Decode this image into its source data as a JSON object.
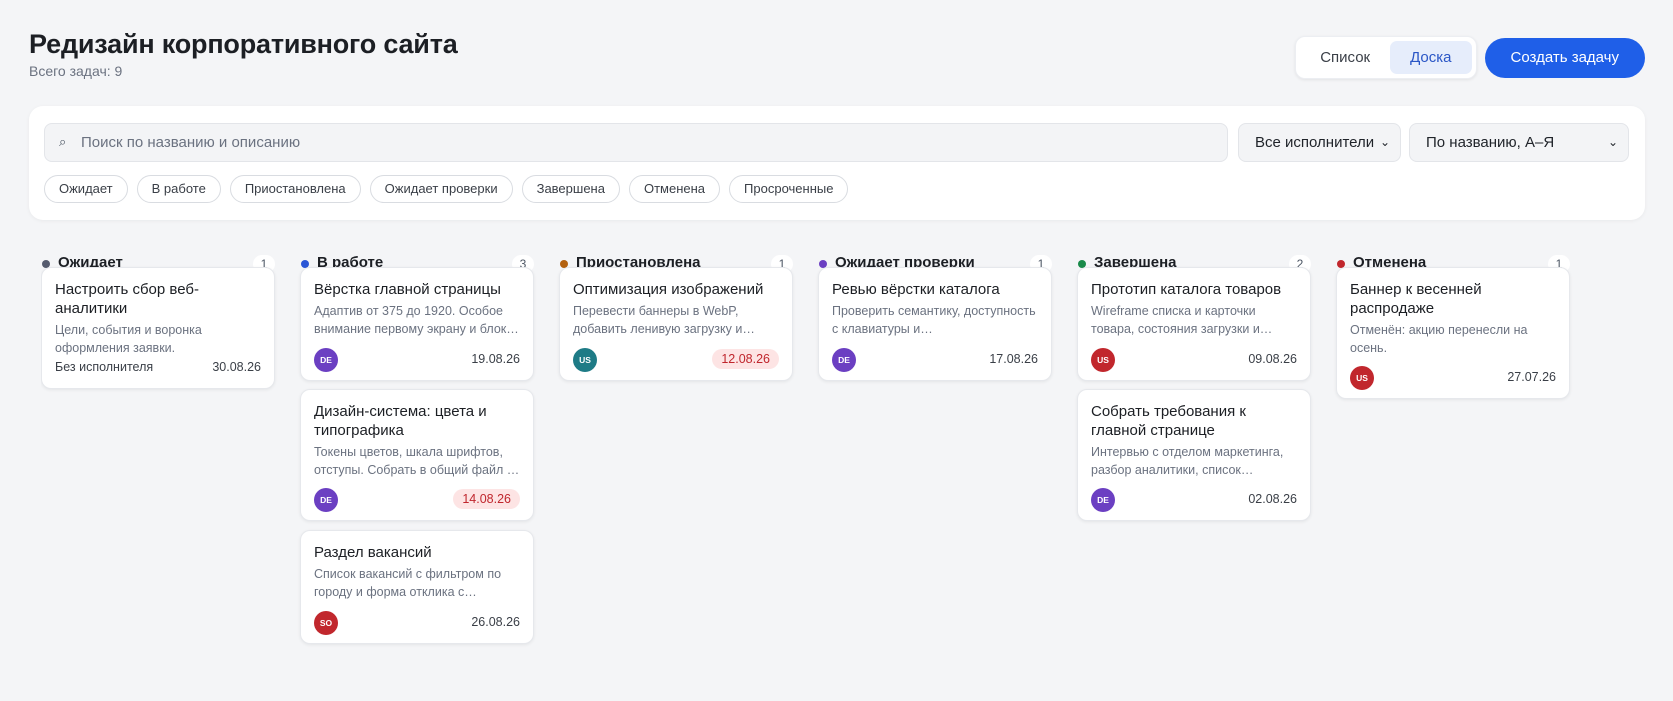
{
  "header": {
    "title": "Редизайн корпоративного сайта",
    "subtitle": "Всего задач: 9",
    "view_list": "Список",
    "view_board": "Доска",
    "create_label": "Создать задачу"
  },
  "filters": {
    "search_placeholder": "Поиск по названию и описанию",
    "search_value": "",
    "assignee_selected": "Все исполнители",
    "sort_selected": "По названию, А–Я",
    "chips": [
      "Ожидает",
      "В работе",
      "Приостановлена",
      "Ожидает проверки",
      "Завершена",
      "Отменена",
      "Просроченные"
    ]
  },
  "columns": [
    {
      "title": "Ожидает",
      "count": "1",
      "color": "#555b6e",
      "cards": [
        {
          "title": "Настроить сбор веб-аналитики",
          "desc": "Цели, события и воронка оформления заявки.",
          "assignee": "",
          "no_assignee_label": "Без исполнителя",
          "avatar_color": "",
          "date": "30.08.26",
          "overdue": false
        }
      ]
    },
    {
      "title": "В работе",
      "count": "3",
      "color": "#2a56d6",
      "cards": [
        {
          "title": "Вёрстка главной страницы",
          "desc": "Адаптив от 375 до 1920. Особое внимание первому экрану и блок…",
          "assignee": "DE",
          "avatar_color": "#6b3fc2",
          "date": "19.08.26",
          "overdue": false
        },
        {
          "title": "Дизайн-система: цвета и типографика",
          "desc": "Токены цветов, шкала шрифтов, отступы. Собрать в общий файл …",
          "assignee": "DE",
          "avatar_color": "#6b3fc2",
          "date": "14.08.26",
          "overdue": true
        },
        {
          "title": "Раздел вакансий",
          "desc": "Список вакансий с фильтром по городу и форма отклика с…",
          "assignee": "SO",
          "avatar_color": "#c1272d",
          "date": "26.08.26",
          "overdue": false
        }
      ]
    },
    {
      "title": "Приостановлена",
      "count": "1",
      "color": "#b3610f",
      "cards": [
        {
          "title": "Оптимизация изображений",
          "desc": "Перевести баннеры в WebP, добавить ленивую загрузку и…",
          "assignee": "US",
          "avatar_color": "#1e7b86",
          "date": "12.08.26",
          "overdue": true
        }
      ]
    },
    {
      "title": "Ожидает проверки",
      "count": "1",
      "color": "#6b3fc2",
      "cards": [
        {
          "title": "Ревью вёрстки каталога",
          "desc": "Проверить семантику, доступность с клавиатуры и…",
          "assignee": "DE",
          "avatar_color": "#6b3fc2",
          "date": "17.08.26",
          "overdue": false
        }
      ]
    },
    {
      "title": "Завершена",
      "count": "2",
      "color": "#1a8a4a",
      "cards": [
        {
          "title": "Прототип каталога товаров",
          "desc": "Wireframe списка и карточки товара, состояния загрузки и…",
          "assignee": "US",
          "avatar_color": "#c1272d",
          "date": "09.08.26",
          "overdue": false
        },
        {
          "title": "Собрать требования к главной странице",
          "desc": "Интервью с отделом маркетинга, разбор аналитики, список…",
          "assignee": "DE",
          "avatar_color": "#6b3fc2",
          "date": "02.08.26",
          "overdue": false
        }
      ]
    },
    {
      "title": "Отменена",
      "count": "1",
      "color": "#c1272d",
      "cards": [
        {
          "title": "Баннер к весенней распродаже",
          "desc": "Отменён: акцию перенесли на осень.",
          "assignee": "US",
          "avatar_color": "#c1272d",
          "date": "27.07.26",
          "overdue": false
        }
      ]
    }
  ]
}
